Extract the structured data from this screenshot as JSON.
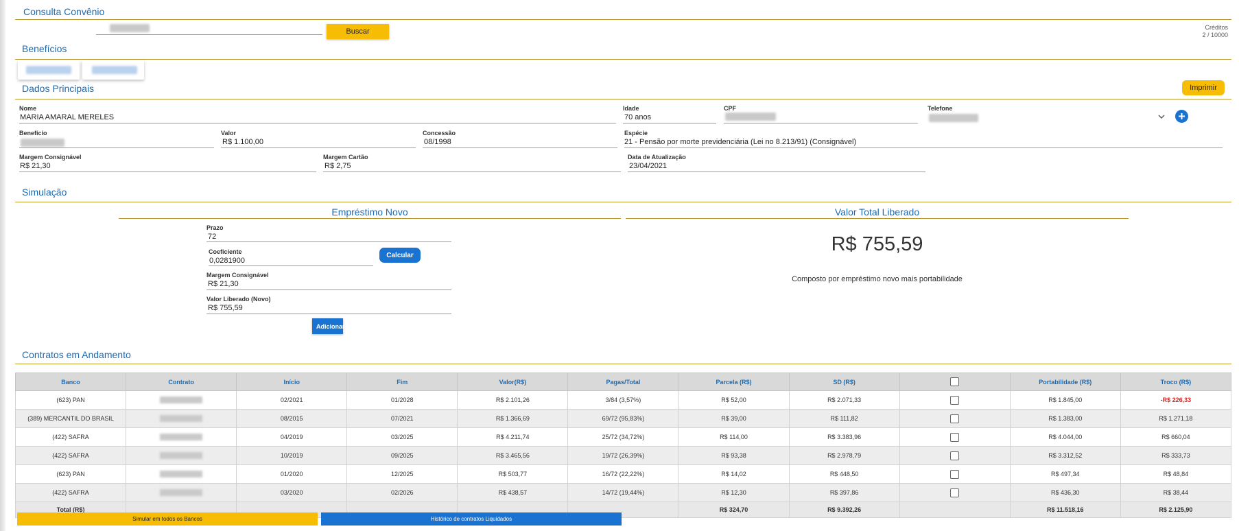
{
  "consulta": {
    "title": "Consulta Convênio",
    "search_button": "Buscar",
    "credits_label": "Créditos",
    "credits_value": "2 / 10000"
  },
  "beneficios": {
    "title": "Benefícios"
  },
  "dados": {
    "title": "Dados Principais",
    "print_button": "Imprimir",
    "nome_label": "Nome",
    "nome": "MARIA AMARAL MERELES",
    "idade_label": "Idade",
    "idade": "70 anos",
    "cpf_label": "CPF",
    "telefone_label": "Telefone",
    "beneficio_label": "Benefício",
    "valor_label": "Valor",
    "valor": "R$ 1.100,00",
    "concessao_label": "Concessão",
    "concessao": "08/1998",
    "especie_label": "Espécie",
    "especie": "21 - Pensão por morte previdenciária (Lei no 8.213/91) (Consignável)",
    "margem_consignavel_label": "Margem Consignável",
    "margem_consignavel": "R$ 21,30",
    "margem_cartao_label": "Margem Cartão",
    "margem_cartao": "R$ 2,75",
    "data_atualizacao_label": "Data de Atualização",
    "data_atualizacao": "23/04/2021"
  },
  "simulacao": {
    "title": "Simulação",
    "emprestimo_title": "Empréstimo Novo",
    "prazo_label": "Prazo",
    "prazo": "72",
    "coeficiente_label": "Coeficiente",
    "coeficiente": "0,0281900",
    "calcular_button": "Calcular",
    "margem_label": "Margem Consignável",
    "margem": "R$ 21,30",
    "valor_liberado_label": "Valor Liberado (Novo)",
    "valor_liberado": "R$ 755,59",
    "adicionar_button": "Adicionar",
    "total_title": "Valor Total Liberado",
    "total_value": "R$ 755,59",
    "total_caption": "Composto por empréstimo novo mais portabilidade"
  },
  "contratos": {
    "title": "Contratos em Andamento",
    "headers": {
      "banco": "Banco",
      "contrato": "Contrato",
      "inicio": "Início",
      "fim": "Fim",
      "valor": "Valor(R$)",
      "pagas": "Pagas/Total",
      "parcela": "Parcela (R$)",
      "sd": "SD (R$)",
      "portabilidade": "Portabilidade (R$)",
      "troco": "Troco (R$)"
    },
    "rows": [
      {
        "banco": "(623) PAN",
        "inicio": "02/2021",
        "fim": "01/2028",
        "valor": "R$ 2.101,26",
        "pagas": "3/84 (3,57%)",
        "parcela": "R$ 52,00",
        "sd": "R$ 2.071,33",
        "portabilidade": "R$ 1.845,00",
        "troco": "-R$ 226,33"
      },
      {
        "banco": "(389) MERCANTIL DO BRASIL",
        "inicio": "08/2015",
        "fim": "07/2021",
        "valor": "R$ 1.366,69",
        "pagas": "69/72 (95,83%)",
        "parcela": "R$ 39,00",
        "sd": "R$ 111,82",
        "portabilidade": "R$ 1.383,00",
        "troco": "R$ 1.271,18"
      },
      {
        "banco": "(422) SAFRA",
        "inicio": "04/2019",
        "fim": "03/2025",
        "valor": "R$ 4.211,74",
        "pagas": "25/72 (34,72%)",
        "parcela": "R$ 114,00",
        "sd": "R$ 3.383,96",
        "portabilidade": "R$ 4.044,00",
        "troco": "R$ 660,04"
      },
      {
        "banco": "(422) SAFRA",
        "inicio": "10/2019",
        "fim": "09/2025",
        "valor": "R$ 3.465,56",
        "pagas": "19/72 (26,39%)",
        "parcela": "R$ 93,38",
        "sd": "R$ 2.978,79",
        "portabilidade": "R$ 3.312,52",
        "troco": "R$ 333,73"
      },
      {
        "banco": "(623) PAN",
        "inicio": "01/2020",
        "fim": "12/2025",
        "valor": "R$ 503,77",
        "pagas": "16/72 (22,22%)",
        "parcela": "R$ 14,02",
        "sd": "R$ 448,50",
        "portabilidade": "R$ 497,34",
        "troco": "R$ 48,84"
      },
      {
        "banco": "(422) SAFRA",
        "inicio": "03/2020",
        "fim": "02/2026",
        "valor": "R$ 438,57",
        "pagas": "14/72 (19,44%)",
        "parcela": "R$ 12,30",
        "sd": "R$ 397,86",
        "portabilidade": "R$ 436,30",
        "troco": "R$ 38,44"
      }
    ],
    "total": {
      "label": "Total (R$)",
      "parcela": "R$ 324,70",
      "sd": "R$ 9.392,26",
      "portabilidade": "R$ 11.518,16",
      "troco": "R$ 2.125,90"
    }
  },
  "footer": {
    "simular_button": "Simular em todos os Bancos",
    "historico_button": "Histórico de contratos Liquidados"
  },
  "colors": {
    "accent_blue": "#1a73d1",
    "accent_yellow": "#f7bd05",
    "title_blue": "#1a6bb5",
    "section_line": "#b8962a",
    "negative": "#e02020"
  },
  "icons": {
    "phone_dropdown": "chevron-down-icon",
    "add_phone": "plus-icon"
  }
}
